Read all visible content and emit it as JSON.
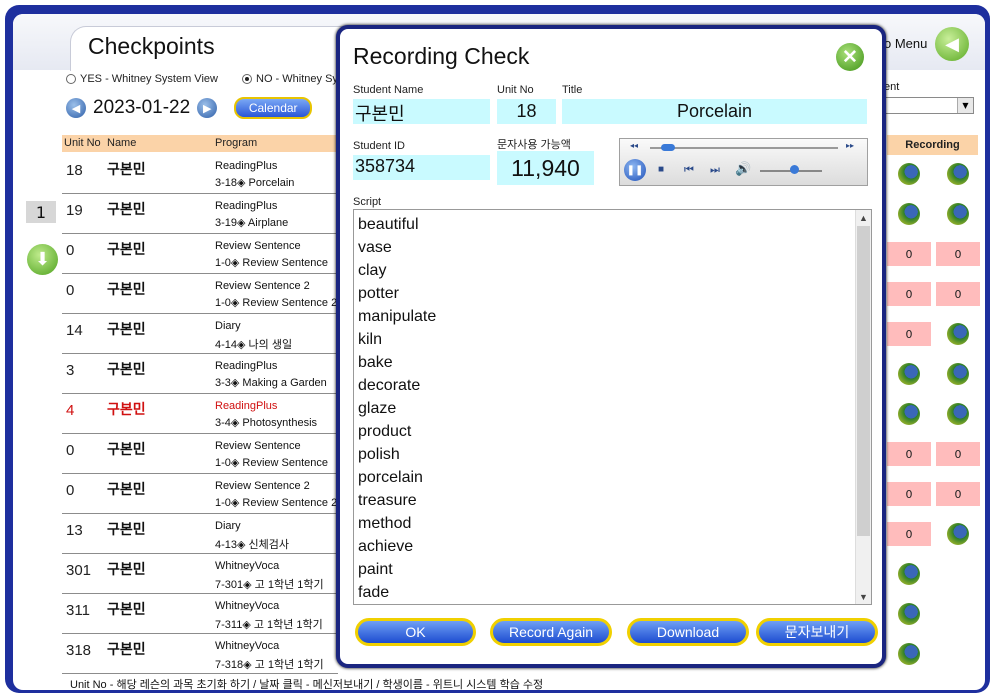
{
  "page": {
    "title": "Checkpoints",
    "menu_label": "o Menu"
  },
  "view_options": [
    {
      "label": "YES - Whitney System View",
      "selected": false
    },
    {
      "label": "NO - Whitney Sy",
      "selected": true
    }
  ],
  "date_nav": {
    "date": "2023-01-22",
    "calendar_label": "Calendar"
  },
  "table": {
    "headers": {
      "unit_no": "Unit No",
      "name": "Name",
      "program": "Program",
      "recording": "Recording"
    },
    "rows": [
      {
        "unit": "18",
        "name": "구본민",
        "program": "ReadingPlus",
        "lesson": "3-18◈ Porcelain"
      },
      {
        "unit": "19",
        "name": "구본민",
        "program": "ReadingPlus",
        "lesson": "3-19◈ Airplane"
      },
      {
        "unit": "0",
        "name": "구본민",
        "program": "Review Sentence",
        "lesson": "1-0◈ Review Sentence"
      },
      {
        "unit": "0",
        "name": "구본민",
        "program": "Review Sentence 2",
        "lesson": "1-0◈ Review Sentence 2"
      },
      {
        "unit": "14",
        "name": "구본민",
        "program": "Diary",
        "lesson": "4-14◈ 나의 생일"
      },
      {
        "unit": "3",
        "name": "구본민",
        "program": "ReadingPlus",
        "lesson": "3-3◈ Making a Garden"
      },
      {
        "unit": "4",
        "name": "구본민",
        "program": "ReadingPlus",
        "lesson": "3-4◈ Photosynthesis",
        "highlight": true
      },
      {
        "unit": "0",
        "name": "구본민",
        "program": "Review Sentence",
        "lesson": "1-0◈ Review Sentence"
      },
      {
        "unit": "0",
        "name": "구본민",
        "program": "Review Sentence 2",
        "lesson": "1-0◈ Review Sentence 2"
      },
      {
        "unit": "13",
        "name": "구본민",
        "program": "Diary",
        "lesson": "4-13◈ 신체검사"
      },
      {
        "unit": "301",
        "name": "구본민",
        "program": "WhitneyVoca",
        "lesson": "7-301◈ 고 1학년 1학기"
      },
      {
        "unit": "311",
        "name": "구본민",
        "program": "WhitneyVoca",
        "lesson": "7-311◈ 고 1학년 1학기"
      },
      {
        "unit": "318",
        "name": "구본민",
        "program": "WhitneyVoca",
        "lesson": "7-318◈ 고 1학년 1학기"
      }
    ]
  },
  "recording_zero": "0",
  "right_panel": {
    "label": "ent"
  },
  "pagination": {
    "page": "1"
  },
  "footer": "Unit No - 해당 레슨의 과목 초기화 하기  /  날짜 클릭 - 메신저보내기  /  학생이름 - 위트니 시스템 학습 수정",
  "modal": {
    "title": "Recording Check",
    "student_name_label": "Student Name",
    "student_name": "구본민",
    "unit_no_label": "Unit No",
    "unit_no": "18",
    "title_label": "Title",
    "lesson_title": "Porcelain",
    "student_id_label": "Student ID",
    "student_id": "358734",
    "sms_label": "문자사용 가능액",
    "sms_amount": "11,940",
    "script_label": "Script",
    "script": [
      "beautiful",
      "vase",
      "clay",
      "potter",
      "manipulate",
      "kiln",
      "bake",
      "decorate",
      "glaze",
      "product",
      "polish",
      "porcelain",
      "treasure",
      "method",
      "achieve",
      "paint",
      "fade"
    ],
    "buttons": {
      "ok": "OK",
      "record_again": "Record Again",
      "download": "Download",
      "send_sms": "문자보내기"
    },
    "player": {
      "progress": 0.08,
      "volume": 0.55
    }
  }
}
